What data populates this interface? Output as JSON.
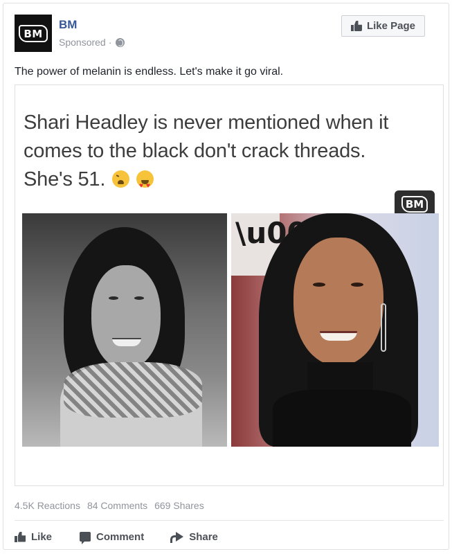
{
  "header": {
    "page_name": "BM",
    "avatar_text": "BM",
    "sponsored_label": "Sponsored",
    "separator": "·",
    "privacy_icon": "globe-icon",
    "like_page_label": "Like Page",
    "like_page_icon": "thumbs-up-icon"
  },
  "post": {
    "text": "The power of melanin is endless. Let's make it go viral."
  },
  "media": {
    "quote_line1": "Shari Headley is never mentioned when it",
    "quote_line2": "comes to the black don't crack threads.",
    "quote_line3": "She's 51.",
    "emojis": [
      "weary-face-emoji",
      "heart-eyes-emoji"
    ],
    "watermark_text": "BM",
    "left_photo": "black-and-white-portrait",
    "right_photo": "color-portrait"
  },
  "stats": {
    "reactions": "4.5K Reactions",
    "comments": "84 Comments",
    "shares": "669 Shares"
  },
  "actions": {
    "like_label": "Like",
    "comment_label": "Comment",
    "share_label": "Share"
  },
  "colors": {
    "link_blue": "#365899",
    "meta_gray": "#90949c",
    "action_gray": "#4b4f56"
  }
}
